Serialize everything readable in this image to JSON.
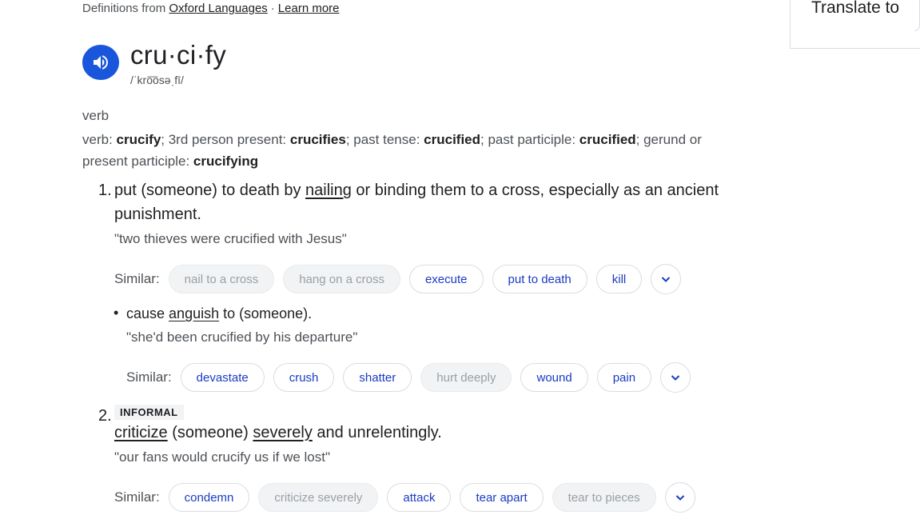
{
  "source": {
    "prefix": "Definitions from",
    "link": "Oxford Languages",
    "sep": "·",
    "learn_more": "Learn more"
  },
  "translate": {
    "label": "Translate to"
  },
  "entry": {
    "word": "cru·ci·fy",
    "phonetic": "/ˈkro͞osəˌfī/",
    "pos": "verb"
  },
  "forms": {
    "l1": "verb: ",
    "w1": "crucify",
    "l2": "; 3rd person present: ",
    "w2": "crucifies",
    "l3": "; past tense: ",
    "w3": "crucified",
    "l4": "; past participle: ",
    "w4": "crucified",
    "l5": "; gerund or present participle: ",
    "w5": "crucifying"
  },
  "sense1": {
    "num": "1.",
    "def_a": "put (someone) to death by ",
    "def_link": "nailing",
    "def_b": " or binding them to a cross, especially as an ancient punishment.",
    "example": "\"two thieves were crucified with Jesus\"",
    "similar_label": "Similar:",
    "similar": [
      "nail to a cross",
      "hang on a cross",
      "execute",
      "put to death",
      "kill"
    ],
    "sub": {
      "def_a": "cause ",
      "def_link": "anguish",
      "def_b": " to (someone).",
      "example": "\"she'd been crucified by his departure\"",
      "similar_label": "Similar:",
      "similar": [
        "devastate",
        "crush",
        "shatter",
        "hurt deeply",
        "wound",
        "pain"
      ]
    }
  },
  "sense2": {
    "num": "2.",
    "tag": "INFORMAL",
    "def_link1": "criticize",
    "def_mid": " (someone) ",
    "def_link2": "severely",
    "def_end": " and unrelentingly.",
    "example": "\"our fans would crucify us if we lost\"",
    "similar_label": "Similar:",
    "similar": [
      "condemn",
      "criticize severely",
      "attack",
      "tear apart",
      "tear to pieces"
    ]
  }
}
